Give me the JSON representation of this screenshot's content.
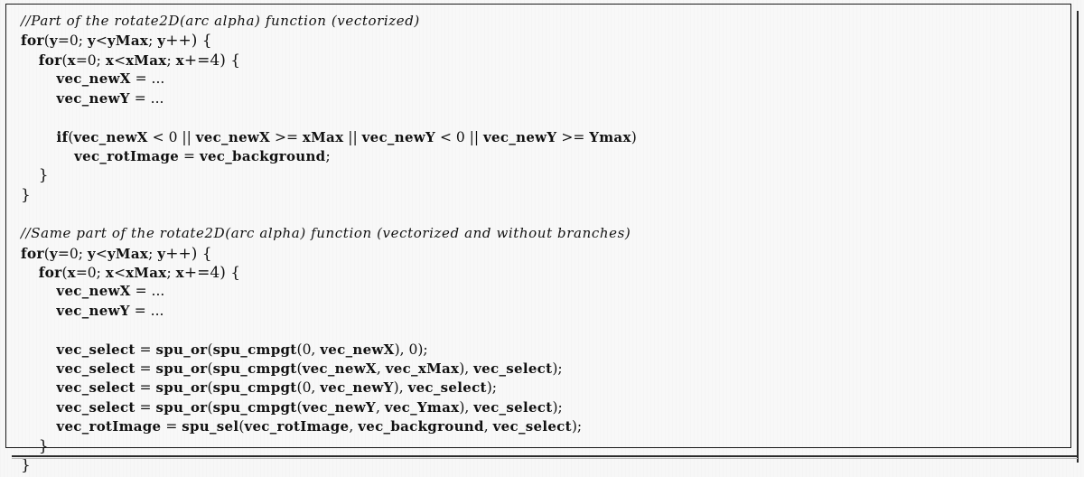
{
  "figure": {
    "kind": "code-listing",
    "language": "C (Cell SPU intrinsics)",
    "background_color": "#f7f7f7",
    "text_color": "#111111",
    "border_color": "#1a1a1a"
  },
  "listing": {
    "lines": [
      {
        "indent": 0,
        "style": "cmt",
        "text": "//Part of the rotate2D(arc alpha) function (vectorized)"
      },
      {
        "indent": 0,
        "style": "code",
        "text": "for(y=0; y<yMax; y++) {"
      },
      {
        "indent": 1,
        "style": "code",
        "text": "for(x=0; x<xMax; x+=4) {"
      },
      {
        "indent": 2,
        "style": "code",
        "text": "vec_newX = ..."
      },
      {
        "indent": 2,
        "style": "code",
        "text": "vec_newY = ..."
      },
      {
        "indent": 0,
        "style": "blank",
        "text": ""
      },
      {
        "indent": 2,
        "style": "code",
        "text": "if(vec_newX < 0 || vec_newX >= xMax || vec_newY < 0 || vec_newY >= Ymax)"
      },
      {
        "indent": 3,
        "style": "code",
        "text": "vec_rotImage = vec_background;"
      },
      {
        "indent": 1,
        "style": "code",
        "text": "}"
      },
      {
        "indent": 0,
        "style": "code",
        "text": "}"
      },
      {
        "indent": 0,
        "style": "blank",
        "text": ""
      },
      {
        "indent": 0,
        "style": "cmt",
        "text": "//Same part of the rotate2D(arc alpha) function (vectorized and without branches)"
      },
      {
        "indent": 0,
        "style": "code",
        "text": "for(y=0; y<yMax; y++) {"
      },
      {
        "indent": 1,
        "style": "code",
        "text": "for(x=0; x<xMax; x+=4) {"
      },
      {
        "indent": 2,
        "style": "code",
        "text": "vec_newX = ..."
      },
      {
        "indent": 2,
        "style": "code",
        "text": "vec_newY = ..."
      },
      {
        "indent": 0,
        "style": "blank",
        "text": ""
      },
      {
        "indent": 2,
        "style": "code",
        "text": "vec_select = spu_or(spu_cmpgt(0, vec_newX), 0);"
      },
      {
        "indent": 2,
        "style": "code",
        "text": "vec_select = spu_or(spu_cmpgt(vec_newX, vec_xMax), vec_select);"
      },
      {
        "indent": 2,
        "style": "code",
        "text": "vec_select = spu_or(spu_cmpgt(0, vec_newY), vec_select);"
      },
      {
        "indent": 2,
        "style": "code",
        "text": "vec_select = spu_or(spu_cmpgt(vec_newY, vec_Ymax), vec_select);"
      },
      {
        "indent": 2,
        "style": "code",
        "text": "vec_rotImage = spu_sel(vec_rotImage, vec_background, vec_select);"
      },
      {
        "indent": 1,
        "style": "code",
        "text": "}"
      },
      {
        "indent": 0,
        "style": "code",
        "text": "}"
      }
    ]
  }
}
